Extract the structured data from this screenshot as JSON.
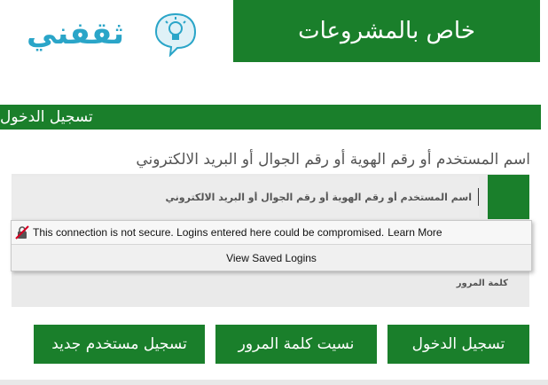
{
  "header": {
    "banner_text": "خاص بالمشروعات",
    "logo_text": "ثقفني"
  },
  "section": {
    "title": "تسجيل الدخول"
  },
  "form": {
    "username_label": "اسم المستخدم أو رقم الهوية أو رقم الجوال أو البريد الالكتروني",
    "username_placeholder": "اسم المستخدم أو رقم الهوية أو رقم الجوال أو البريد الالكتروني",
    "password_label": "كلمة المرور"
  },
  "security_popup": {
    "warning_text": "This connection is not secure. Logins entered here could be compromised.",
    "learn_more": "Learn More",
    "saved_logins": "View Saved Logins"
  },
  "buttons": {
    "login": "تسجيل الدخول",
    "forgot_password": "نسيت كلمة المرور",
    "register": "تسجيل مستخدم جديد"
  },
  "colors": {
    "brand_green": "#1a7f2b",
    "logo_blue": "#2aa5c8"
  }
}
